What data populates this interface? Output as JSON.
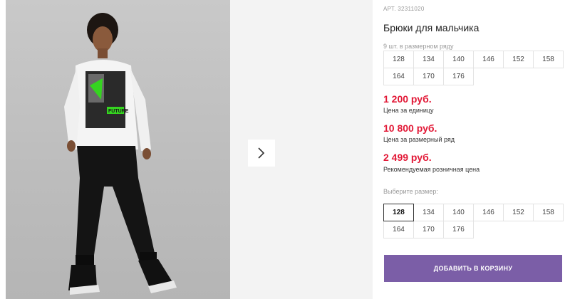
{
  "gallery": {
    "next_icon": "chevron-right-icon",
    "print_text": "FUTURE"
  },
  "product": {
    "sku": "АРТ. 32311020",
    "title": "Брюки для мальчика"
  },
  "size_run": {
    "caption": "9 шт. в размерном ряду",
    "sizes": [
      "128",
      "134",
      "140",
      "146",
      "152",
      "158",
      "164",
      "170",
      "176"
    ]
  },
  "prices": [
    {
      "value": "1 200 руб.",
      "label": "Цена за единицу"
    },
    {
      "value": "10 800 руб.",
      "label": "Цена за размерный ряд"
    },
    {
      "value": "2 499 руб.",
      "label": "Рекомендуемая розничная цена"
    }
  ],
  "size_select": {
    "label": "Выберите размер:",
    "selected": "128",
    "sizes": [
      "128",
      "134",
      "140",
      "146",
      "152",
      "158",
      "164",
      "170",
      "176"
    ]
  },
  "cart": {
    "button_label": "ДОБАВИТЬ В КОРЗИНУ"
  },
  "colors": {
    "price": "#e21836",
    "button": "#7b5ea7"
  }
}
